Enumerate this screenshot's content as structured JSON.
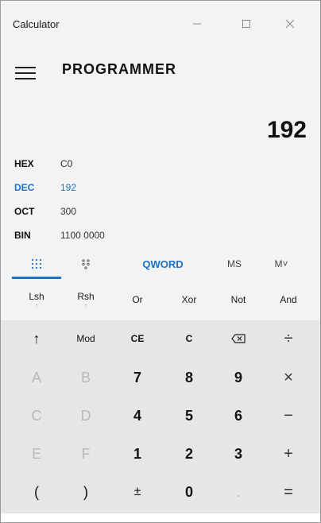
{
  "window": {
    "title": "Calculator",
    "minimize_icon": "—",
    "maximize_icon": "☐",
    "close_icon": "✕"
  },
  "header": {
    "mode_title": "PROGRAMMER",
    "menu_icon": "hamburger-menu-icon"
  },
  "display": {
    "value": "192"
  },
  "radix": [
    {
      "label": "HEX",
      "value": "C0"
    },
    {
      "label": "DEC",
      "value": "192"
    },
    {
      "label": "OCT",
      "value": "300"
    },
    {
      "label": "BIN",
      "value": "1100 0000"
    }
  ],
  "tabs": {
    "keypad_icon": "keypad-icon",
    "bits_icon": "bit-toggle-icon",
    "word_size": "QWORD",
    "memory_store": "MS",
    "memory_view": "M˅"
  },
  "ops": [
    {
      "label": "Lsh",
      "sub": "↑"
    },
    {
      "label": "Rsh",
      "sub": "↑"
    },
    {
      "label": "Or",
      "sub": ""
    },
    {
      "label": "Xor",
      "sub": ""
    },
    {
      "label": "Not",
      "sub": ""
    },
    {
      "label": "And",
      "sub": ""
    }
  ],
  "keys": [
    [
      "↑",
      "Mod",
      "CE",
      "C",
      "⌫",
      "÷"
    ],
    [
      "A",
      "B",
      "7",
      "8",
      "9",
      "×"
    ],
    [
      "C",
      "D",
      "4",
      "5",
      "6",
      "−"
    ],
    [
      "E",
      "F",
      "1",
      "2",
      "3",
      "+"
    ],
    [
      "(",
      ")",
      "±",
      "0",
      ".",
      "="
    ]
  ],
  "colors": {
    "accent": "#1d72c4",
    "panel": "#f3f3f3",
    "keypad": "#e6e6e6"
  }
}
